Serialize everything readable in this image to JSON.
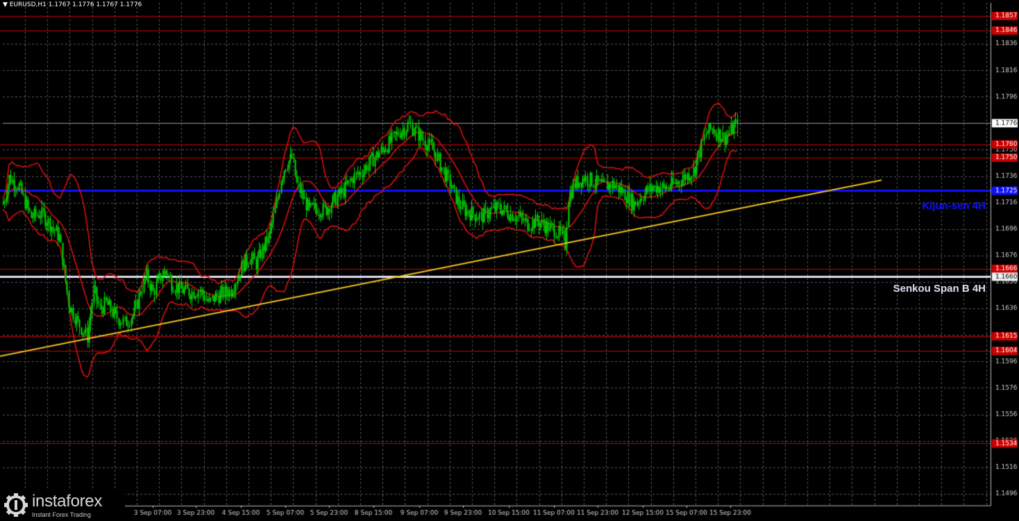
{
  "header": {
    "symbol_label": "▼ EURUSD,H1  1.1767 1.1776 1.1767 1.1776"
  },
  "annotations": {
    "kijun_label": "Kijun-sen 4H",
    "senkou_label": "Senkou Span B 4H"
  },
  "logo": {
    "brand": "instaforex",
    "tagline": "Instant Forex Trading"
  },
  "colors": {
    "background": "#000000",
    "grid": "#5a5a5a",
    "candle": "#00e000",
    "level_line": "#cc0000",
    "ichimoku_lines": "#e01010",
    "kijun": "#1010ff",
    "senkou": "#e6dcf0",
    "trendline": "#f0c020",
    "level_label_bg": "#cc0000",
    "current_price_label_bg": "#ffffff"
  },
  "chart_data": {
    "type": "candlestick",
    "symbol": "EURUSD",
    "timeframe": "H1",
    "ylim": [
      1.1487,
      1.1867
    ],
    "y_ticks": [
      "1.1857",
      "1.1846",
      "1.1836",
      "1.1816",
      "1.1796",
      "1.1776",
      "1.1756",
      "1.1736",
      "1.1716",
      "1.1696",
      "1.1676",
      "1.1656",
      "1.1636",
      "1.1616",
      "1.1596",
      "1.1576",
      "1.1556",
      "1.1536",
      "1.1516",
      "1.1496"
    ],
    "x_ticks": [
      "3 Sep 07:00",
      "3 Sep 23:00",
      "4 Sep 15:00",
      "5 Sep 07:00",
      "5 Sep 23:00",
      "8 Sep 15:00",
      "9 Sep 07:00",
      "9 Sep 23:00",
      "10 Sep 15:00",
      "11 Sep 07:00",
      "11 Sep 23:00",
      "12 Sep 15:00",
      "15 Sep 07:00",
      "15 Sep 23:00"
    ],
    "levels": [
      {
        "price": 1.1857,
        "label": "1.1857"
      },
      {
        "price": 1.1846,
        "label": "1.1846"
      },
      {
        "price": 1.176,
        "label": "1.1760"
      },
      {
        "price": 1.175,
        "label": "1.1750"
      },
      {
        "price": 1.1666,
        "label": "1.1666"
      },
      {
        "price": 1.1615,
        "label": "1.1615"
      },
      {
        "price": 1.1604,
        "label": "1.1604"
      },
      {
        "price": 1.1534,
        "label": "1.1534"
      }
    ],
    "kijun_sen_4h": {
      "price": 1.1725,
      "label": "1.1725"
    },
    "senkou_span_b_4h": {
      "price": 1.166,
      "label": "1.1660"
    },
    "current_price": {
      "price": 1.1776,
      "label": "1.1776"
    },
    "trendline": {
      "start": {
        "bar": 0,
        "price": 1.16
      },
      "end": {
        "bar": 298,
        "price": 1.1733
      }
    },
    "close_path": [
      [
        0,
        1.1715
      ],
      [
        4,
        1.1735
      ],
      [
        10,
        1.1728
      ],
      [
        18,
        1.1705
      ],
      [
        24,
        1.1708
      ],
      [
        30,
        1.17
      ],
      [
        36,
        1.169
      ],
      [
        42,
        1.164
      ],
      [
        48,
        1.1625
      ],
      [
        54,
        1.1615
      ],
      [
        58,
        1.165
      ],
      [
        62,
        1.1635
      ],
      [
        66,
        1.164
      ],
      [
        72,
        1.163
      ],
      [
        78,
        1.1625
      ],
      [
        84,
        1.1632
      ],
      [
        88,
        1.165
      ],
      [
        92,
        1.166
      ],
      [
        96,
        1.1648
      ],
      [
        100,
        1.1658
      ],
      [
        104,
        1.1665
      ],
      [
        108,
        1.1655
      ],
      [
        114,
        1.165
      ],
      [
        120,
        1.1648
      ],
      [
        126,
        1.165
      ],
      [
        132,
        1.164
      ],
      [
        136,
        1.1645
      ],
      [
        142,
        1.1648
      ],
      [
        146,
        1.165
      ],
      [
        150,
        1.166
      ],
      [
        154,
        1.167
      ],
      [
        158,
        1.1675
      ],
      [
        162,
        1.167
      ],
      [
        166,
        1.168
      ],
      [
        170,
        1.169
      ],
      [
        174,
        1.171
      ],
      [
        176,
        1.172
      ],
      [
        178,
        1.1735
      ],
      [
        181,
        1.1745
      ],
      [
        185,
        1.175
      ],
      [
        188,
        1.173
      ],
      [
        192,
        1.172
      ],
      [
        196,
        1.171
      ],
      [
        200,
        1.1712
      ],
      [
        206,
        1.171
      ],
      [
        212,
        1.1718
      ],
      [
        218,
        1.1725
      ],
      [
        224,
        1.1735
      ],
      [
        230,
        1.174
      ],
      [
        236,
        1.1748
      ],
      [
        242,
        1.1755
      ],
      [
        248,
        1.1762
      ],
      [
        254,
        1.177
      ],
      [
        260,
        1.1775
      ],
      [
        264,
        1.177
      ],
      [
        268,
        1.1765
      ],
      [
        272,
        1.176
      ],
      [
        276,
        1.1755
      ],
      [
        280,
        1.1745
      ],
      [
        284,
        1.1735
      ],
      [
        288,
        1.1725
      ]
    ],
    "close_path_2": [
      [
        288,
        1.1725
      ],
      [
        292,
        1.1715
      ],
      [
        296,
        1.171
      ],
      [
        300,
        1.1708
      ],
      [
        306,
        1.1705
      ],
      [
        312,
        1.171
      ],
      [
        318,
        1.1712
      ],
      [
        324,
        1.1708
      ],
      [
        330,
        1.1705
      ],
      [
        336,
        1.17
      ],
      [
        342,
        1.1702
      ],
      [
        348,
        1.1698
      ],
      [
        354,
        1.1695
      ],
      [
        358,
        1.169
      ],
      [
        360,
        1.1685
      ],
      [
        362,
        1.172
      ],
      [
        366,
        1.173
      ],
      [
        372,
        1.1735
      ],
      [
        378,
        1.1732
      ],
      [
        384,
        1.1728
      ],
      [
        390,
        1.173
      ],
      [
        396,
        1.1725
      ],
      [
        400,
        1.172
      ],
      [
        404,
        1.1715
      ],
      [
        408,
        1.172
      ],
      [
        412,
        1.1725
      ],
      [
        418,
        1.1728
      ],
      [
        424,
        1.1727
      ],
      [
        430,
        1.173
      ],
      [
        436,
        1.1735
      ],
      [
        442,
        1.174
      ],
      [
        446,
        1.1755
      ],
      [
        450,
        1.1768
      ],
      [
        454,
        1.1772
      ],
      [
        458,
        1.1768
      ],
      [
        462,
        1.1765
      ],
      [
        466,
        1.177
      ],
      [
        470,
        1.1776
      ]
    ],
    "bars_total": 640
  }
}
